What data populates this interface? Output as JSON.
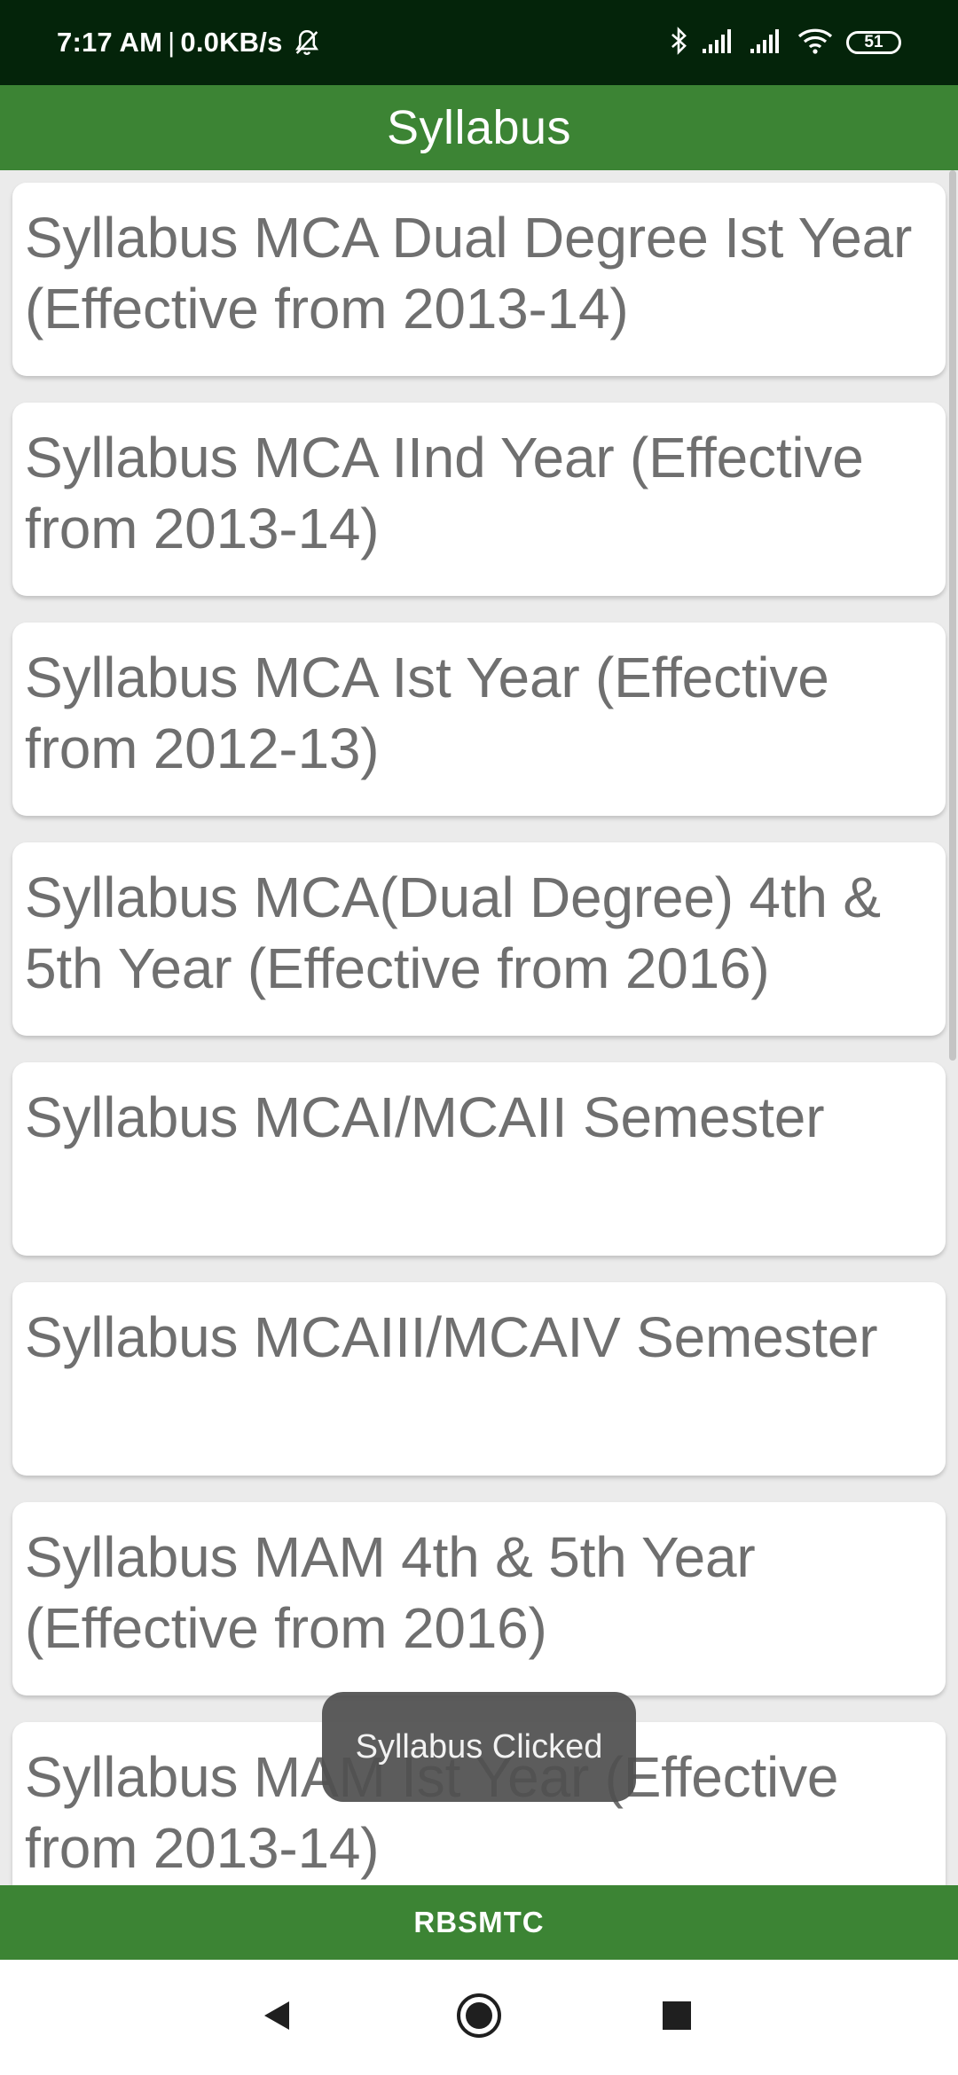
{
  "status_bar": {
    "time": "7:17 AM",
    "separator": "|",
    "network_speed": "0.0KB/s",
    "battery_level": "51",
    "icons": [
      "bell-off-icon",
      "bluetooth-icon",
      "signal-icon",
      "signal-icon",
      "wifi-icon",
      "battery-icon"
    ]
  },
  "app_bar": {
    "title": "Syllabus"
  },
  "list": {
    "items": [
      {
        "label": "Syllabus MCA Dual Degree Ist Year (Effective from 2013-14)"
      },
      {
        "label": "Syllabus MCA IInd Year (Effective from 2013-14)"
      },
      {
        "label": "Syllabus MCA Ist Year (Effective from 2012-13)"
      },
      {
        "label": "Syllabus MCA(Dual Degree) 4th & 5th Year (Effective from 2016)"
      },
      {
        "label": "Syllabus MCAI/MCAII Semester"
      },
      {
        "label": "Syllabus MCAIII/MCAIV Semester"
      },
      {
        "label": "Syllabus MAM 4th & 5th Year (Effective from 2016)"
      },
      {
        "label": "Syllabus MAM Ist Year (Effective from 2013-14)"
      }
    ]
  },
  "toast": {
    "message": "Syllabus Clicked"
  },
  "footer": {
    "label": "RBSMTC"
  },
  "nav_bar": {
    "icons": [
      "back-icon",
      "home-icon",
      "recents-icon"
    ]
  },
  "colors": {
    "status_bar_bg": "#04240a",
    "app_bar_bg": "#3c8434",
    "list_bg": "#ebebeb",
    "card_text": "#6f6f6f"
  }
}
